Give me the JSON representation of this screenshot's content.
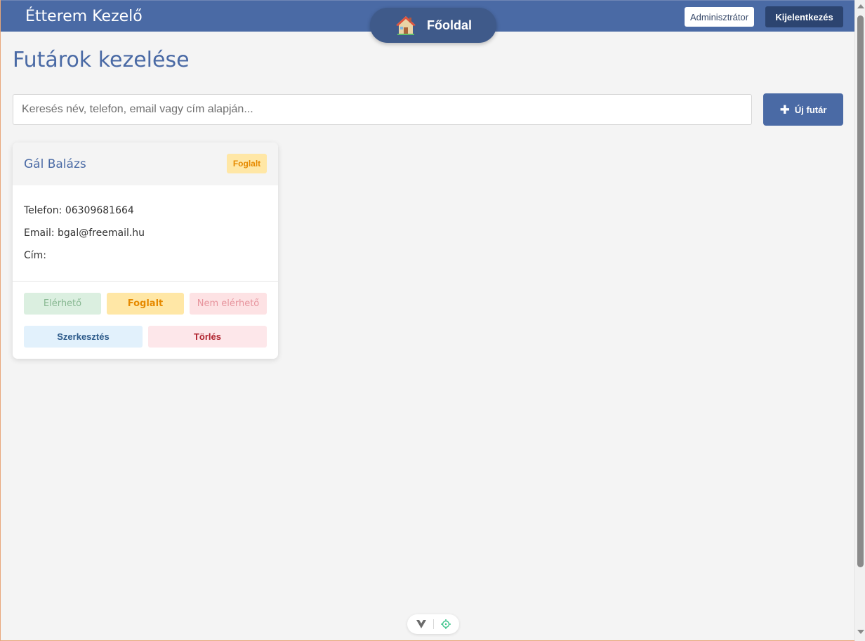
{
  "header": {
    "app_title": "Étterem Kezelő",
    "home_label": "Főoldal",
    "home_icon": "house-icon",
    "role_badge": "Adminisztrátor",
    "logout_label": "Kijelentkezés"
  },
  "page": {
    "title": "Futárok kezelése",
    "search_placeholder": "Keresés név, telefon, email vagy cím alapján...",
    "new_button_label": "Új futár",
    "new_button_icon": "plus-icon"
  },
  "couriers": [
    {
      "name": "Gál Balázs",
      "status": "Foglalt",
      "phone_line": "Telefon: 06309681664",
      "email_line": "Email: bgal@freemail.hu",
      "address_line": "Cím:",
      "status_buttons": [
        "Elérhető",
        "Foglalt",
        "Nem elérhető"
      ],
      "edit_label": "Szerkesztés",
      "delete_label": "Törlés"
    }
  ],
  "colors": {
    "primary": "#4a6aa5",
    "dark": "#2c4470",
    "busy_bg": "#ffe7a6",
    "busy_text": "#e68a00",
    "delete_text": "#b0232e"
  }
}
